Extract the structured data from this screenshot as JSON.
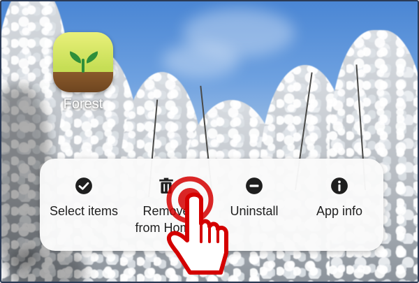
{
  "app": {
    "label": "Forest",
    "icon": "forest-sprout-icon"
  },
  "context_menu": {
    "items": [
      {
        "label": "Select items",
        "icon": "check-circle-icon"
      },
      {
        "label": "Remove\nfrom Home",
        "icon": "trash-icon"
      },
      {
        "label": "Uninstall",
        "icon": "minus-circle-icon"
      },
      {
        "label": "App info",
        "icon": "info-circle-icon"
      }
    ]
  },
  "cursor": {
    "icon": "pointing-hand-icon",
    "color": "#d40000"
  }
}
